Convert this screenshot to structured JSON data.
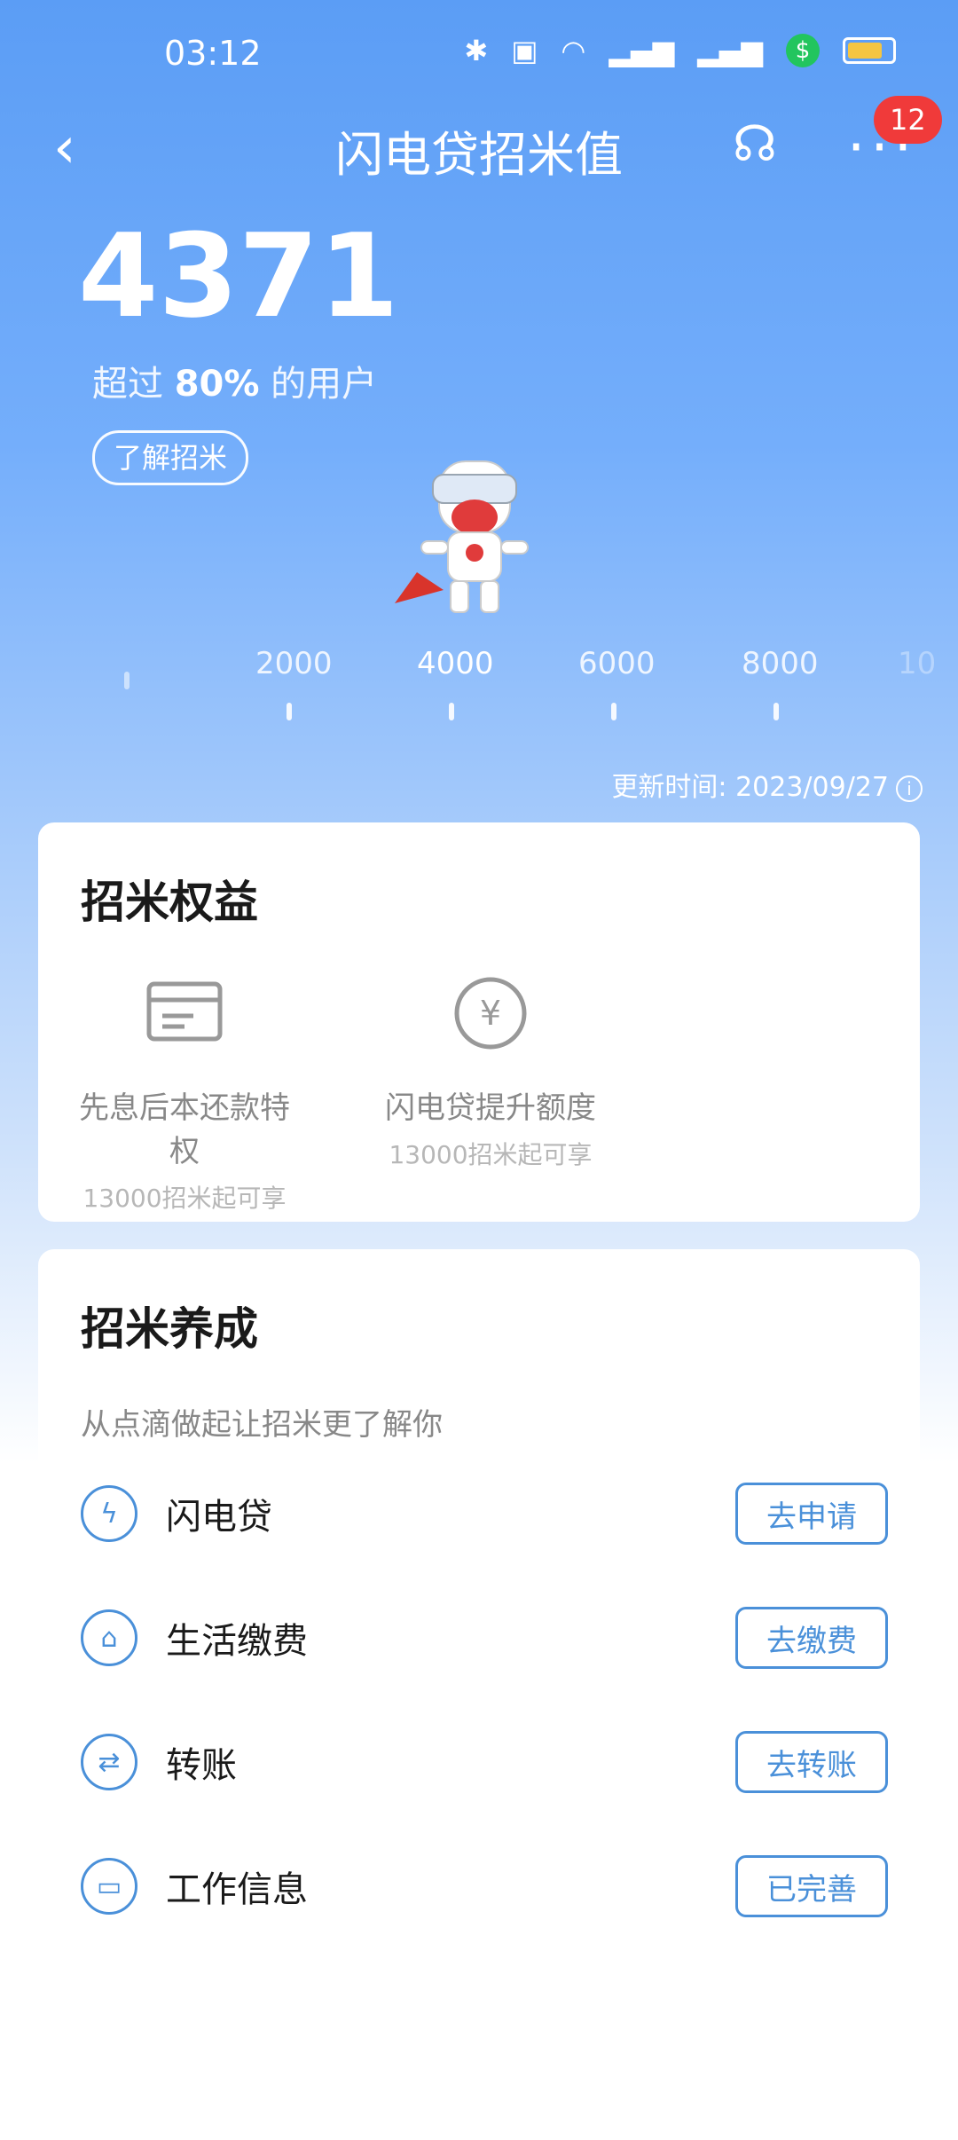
{
  "status": {
    "time": "03:12",
    "icons": [
      "bluetooth-icon",
      "hd-icon",
      "wifi-icon",
      "5g-signal-icon",
      "5g-signal-icon",
      "dollar-icon",
      "battery-icon"
    ]
  },
  "nav": {
    "title": "闪电贷招米值",
    "badge": "12"
  },
  "score": {
    "value": "4371",
    "percent_prefix": "超过 ",
    "percent": "80%",
    "percent_suffix": " 的用户",
    "learn": "了解招米"
  },
  "scale": {
    "labels": [
      "2000",
      "4000",
      "6000",
      "8000",
      "10"
    ]
  },
  "update": {
    "text": "更新时间: 2023/09/27"
  },
  "benefits": {
    "title": "招米权益",
    "items": [
      {
        "name": "先息后本还款特权",
        "sub": "13000招米起可享"
      },
      {
        "name": "闪电贷提升额度",
        "sub": "13000招米起可享"
      }
    ]
  },
  "grow": {
    "title": "招米养成",
    "subtitle": "从点滴做起让招米更了解你",
    "items": [
      {
        "label": "闪电贷",
        "button": "去申请"
      },
      {
        "label": "生活缴费",
        "button": "去缴费"
      },
      {
        "label": "转账",
        "button": "去转账"
      },
      {
        "label": "工作信息",
        "button": "已完善"
      }
    ]
  }
}
